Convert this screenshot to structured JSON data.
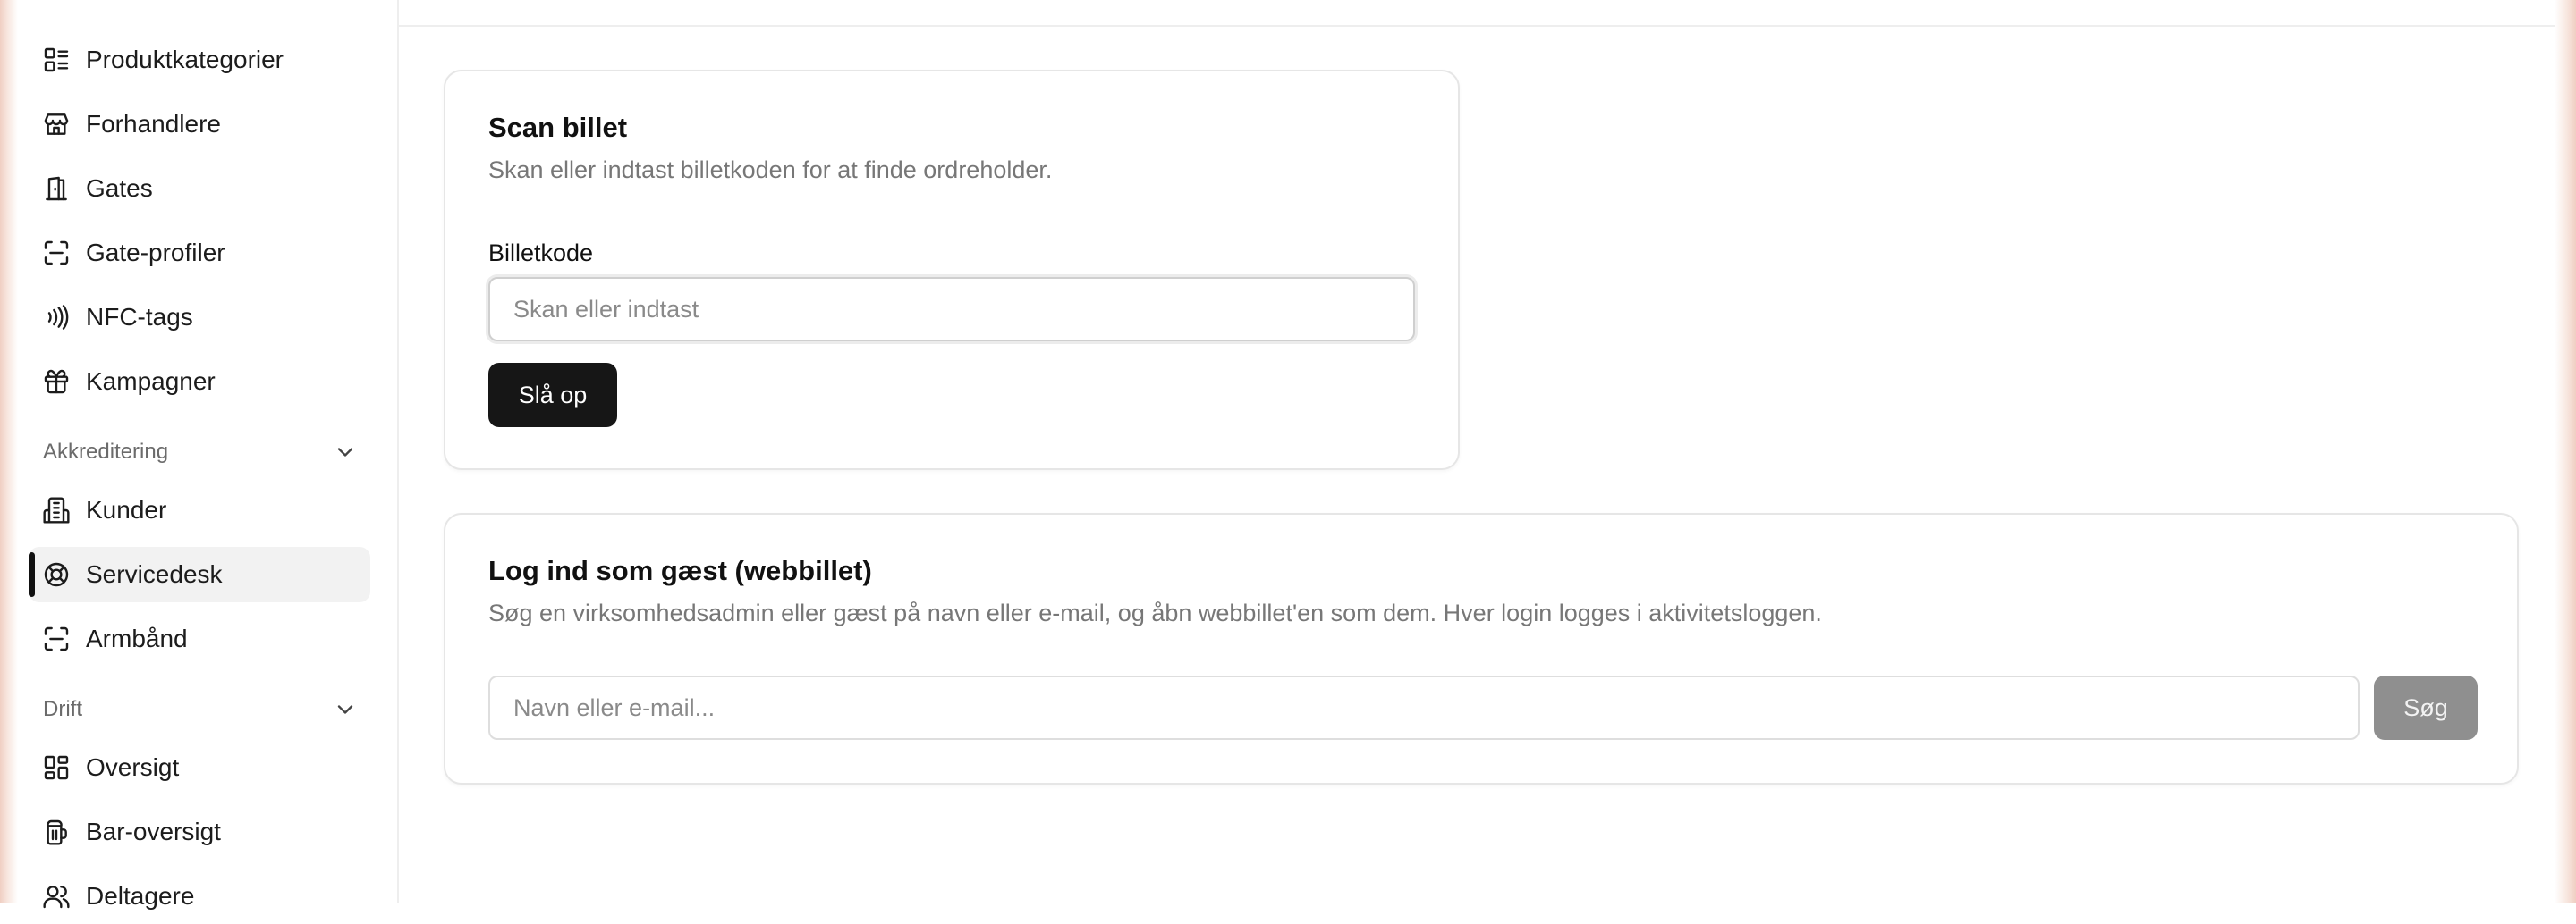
{
  "sidebar": {
    "items": [
      {
        "label": "Produktkategorier",
        "icon": "category-list-icon"
      },
      {
        "label": "Forhandlere",
        "icon": "store-icon"
      },
      {
        "label": "Gates",
        "icon": "door-icon"
      },
      {
        "label": "Gate-profiler",
        "icon": "scan-frame-icon"
      },
      {
        "label": "NFC-tags",
        "icon": "nfc-icon"
      },
      {
        "label": "Kampagner",
        "icon": "gift-icon"
      }
    ],
    "sections": [
      {
        "label": "Akkreditering",
        "items": [
          {
            "label": "Kunder",
            "icon": "building-icon"
          },
          {
            "label": "Servicedesk",
            "icon": "lifebuoy-icon",
            "active": true
          },
          {
            "label": "Armbånd",
            "icon": "scan-frame-icon"
          }
        ]
      },
      {
        "label": "Drift",
        "items": [
          {
            "label": "Oversigt",
            "icon": "dashboard-icon"
          },
          {
            "label": "Bar-oversigt",
            "icon": "beer-icon"
          },
          {
            "label": "Deltagere",
            "icon": "users-icon"
          }
        ]
      }
    ]
  },
  "scan_card": {
    "title": "Scan billet",
    "description": "Skan eller indtast billetkoden for at finde ordreholder.",
    "field_label": "Billetkode",
    "input_placeholder": "Skan eller indtast",
    "input_value": "",
    "button_label": "Slå op"
  },
  "guest_card": {
    "title": "Log ind som gæst (webbillet)",
    "description": "Søg en virksomhedsadmin eller gæst på navn eller e-mail, og åbn webbillet'en som dem. Hver login logges i aktivitetsloggen.",
    "input_placeholder": "Navn eller e-mail...",
    "input_value": "",
    "button_label": "Søg"
  },
  "colors": {
    "primary_button": "#161616",
    "disabled_button": "#8f8f8f",
    "active_nav_bg": "#f2f2f2"
  }
}
